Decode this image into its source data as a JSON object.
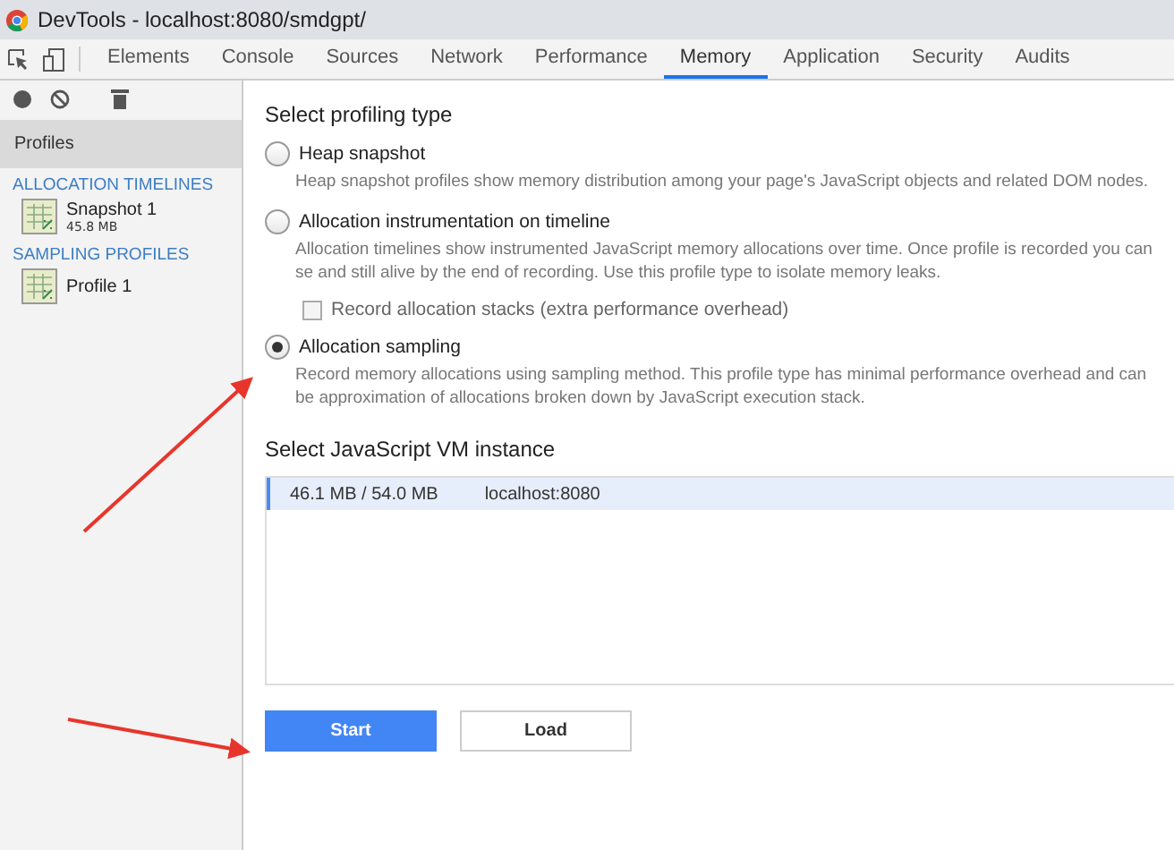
{
  "window": {
    "title": "DevTools - localhost:8080/smdgpt/"
  },
  "tabs": [
    {
      "label": "Elements",
      "selected": false
    },
    {
      "label": "Console",
      "selected": false
    },
    {
      "label": "Sources",
      "selected": false
    },
    {
      "label": "Network",
      "selected": false
    },
    {
      "label": "Performance",
      "selected": false
    },
    {
      "label": "Memory",
      "selected": true
    },
    {
      "label": "Application",
      "selected": false
    },
    {
      "label": "Security",
      "selected": false
    },
    {
      "label": "Audits",
      "selected": false
    }
  ],
  "sidebar": {
    "header": "Profiles",
    "groups": [
      {
        "title": "ALLOCATION TIMELINES",
        "items": [
          {
            "name": "Snapshot 1",
            "size": "45.8 MB"
          }
        ]
      },
      {
        "title": "SAMPLING PROFILES",
        "items": [
          {
            "name": "Profile 1"
          }
        ]
      }
    ]
  },
  "profiling": {
    "heading": "Select profiling type",
    "options": [
      {
        "kind": "radio",
        "label": "Heap snapshot",
        "selected": false,
        "description": "Heap snapshot profiles show memory distribution among your page's JavaScript objects and related DOM nodes."
      },
      {
        "kind": "radio",
        "label": "Allocation instrumentation on timeline",
        "selected": false,
        "description": "Allocation timelines show instrumented JavaScript memory allocations over time. Once profile is recorded you can se and still alive by the end of recording. Use this profile type to isolate memory leaks."
      },
      {
        "kind": "checkbox",
        "label": "Record allocation stacks (extra performance overhead)",
        "checked": false
      },
      {
        "kind": "radio",
        "label": "Allocation sampling",
        "selected": true,
        "description": "Record memory allocations using sampling method. This profile type has minimal performance overhead and can be approximation of allocations broken down by JavaScript execution stack."
      }
    ]
  },
  "vm": {
    "heading": "Select JavaScript VM instance",
    "instances": [
      {
        "memory": "46.1 MB / 54.0 MB",
        "host": "localhost:8080",
        "selected": true
      }
    ]
  },
  "buttons": [
    {
      "label": "Start",
      "kind": "primary"
    },
    {
      "label": "Load",
      "kind": "secondary"
    }
  ]
}
